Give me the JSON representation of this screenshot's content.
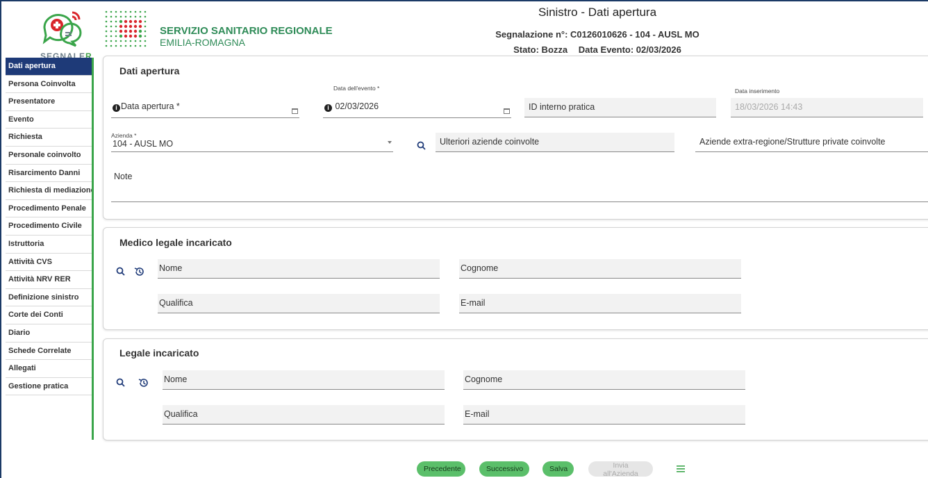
{
  "header": {
    "brand_logo_text_1": "SEGNALE",
    "brand_logo_text_2": "R",
    "ssr_title": "SERVIZIO SANITARIO REGIONALE",
    "ssr_subtitle": "EMILIA-ROMAGNA",
    "page_title": "Sinistro - Dati apertura",
    "report_number": "Segnalazione n°: C0126010626 - 104 - AUSL MO",
    "status": "Stato: Bozza",
    "event_date": "Data Evento: 02/03/2026"
  },
  "sidebar": {
    "items": [
      {
        "label": "Dati apertura"
      },
      {
        "label": "Persona Coinvolta"
      },
      {
        "label": "Presentatore"
      },
      {
        "label": "Evento"
      },
      {
        "label": "Richiesta"
      },
      {
        "label": "Personale coinvolto"
      },
      {
        "label": "Risarcimento Danni"
      },
      {
        "label": "Richiesta di mediazione"
      },
      {
        "label": "Procedimento Penale"
      },
      {
        "label": "Procedimento Civile"
      },
      {
        "label": "Istruttoria"
      },
      {
        "label": "Attività CVS"
      },
      {
        "label": "Attività NRV RER"
      },
      {
        "label": "Definizione sinistro"
      },
      {
        "label": "Corte dei Conti"
      },
      {
        "label": "Diario"
      },
      {
        "label": "Schede Correlate"
      },
      {
        "label": "Allegati"
      },
      {
        "label": "Gestione pratica"
      }
    ]
  },
  "dati_apertura": {
    "title": "Dati apertura",
    "data_apertura_placeholder": "Data apertura *",
    "data_evento_label": "Data dell'evento *",
    "data_evento_value": "02/03/2026",
    "id_interno_placeholder": "ID interno pratica",
    "data_inserimento_label": "Data inserimento",
    "data_inserimento_value": "18/03/2026 14:43",
    "azienda_label": "Azienda *",
    "azienda_value": "104 - AUSL MO",
    "ulteriori_aziende_placeholder": "Ulteriori aziende coinvolte",
    "aziende_extra_placeholder": "Aziende extra-regione/Strutture private coinvolte",
    "note_placeholder": "Note"
  },
  "medico_legale": {
    "title": "Medico legale incaricato",
    "nome": "Nome",
    "cognome": "Cognome",
    "qualifica": "Qualifica",
    "email": "E-mail"
  },
  "legale": {
    "title": "Legale incaricato",
    "nome": "Nome",
    "cognome": "Cognome",
    "qualifica": "Qualifica",
    "email": "E-mail"
  },
  "footer": {
    "prev_label": "Precedente",
    "next_label": "Successivo",
    "save_label": "Salva",
    "send_label": "Invia all'Azienda"
  },
  "colors": {
    "accent_green": "#5bbf6a",
    "nav_active": "#1e3a78",
    "brand_green": "#2e8b57"
  }
}
